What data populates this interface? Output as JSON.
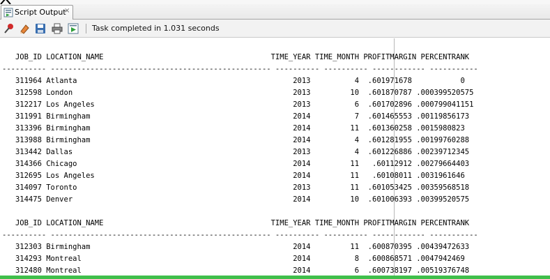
{
  "panel": {
    "tab_title": "Script Output",
    "tab_close": "×",
    "status": "Task completed in 1.031 seconds"
  },
  "icons": {
    "tab": "script-output-icon",
    "toolbar": [
      "pin-icon",
      "eraser-icon",
      "save-icon",
      "print-icon",
      "run-script-icon"
    ]
  },
  "colors": {
    "status_bar": "#3fbf4a"
  },
  "output": {
    "lines": [
      "",
      "   JOB_ID LOCATION_NAME                                      TIME_YEAR TIME_MONTH PROFITMARGIN PERCENTRANK",
      "---------- -------------------------------------------------- ---------- ---------- ------------ -----------",
      "   311964 Atlanta                                                 2013          4  .601971678           0",
      "   312598 London                                                  2013         10  .601870787 .000399520575",
      "   312217 Los Angeles                                             2013          6  .601702896 .000799041151",
      "   311991 Birmingham                                              2014          7  .601465553 .00119856173",
      "   313396 Birmingham                                              2014         11  .601360258 .0015980823",
      "   313988 Birmingham                                              2014          4  .601281955 .00199760288",
      "   313442 Dallas                                                  2013          4  .601226886 .00239712345",
      "   314366 Chicago                                                 2014         11   .60112912 .00279664403",
      "   312695 Los Angeles                                             2014         11   .60108011 .0031961646",
      "   314097 Toronto                                                 2013         11  .601053425 .00359568518",
      "   314475 Denver                                                  2014         10  .601006393 .00399520575",
      "",
      "   JOB_ID LOCATION_NAME                                      TIME_YEAR TIME_MONTH PROFITMARGIN PERCENTRANK",
      "---------- -------------------------------------------------- ---------- ---------- ------------ -----------",
      "   312303 Birmingham                                              2014         11  .600870395 .00439472633",
      "   314293 Montreal                                                2014          8  .600868571 .0047942469",
      "   312480 Montreal                                                2014          6  .600738197 .00519376748"
    ]
  }
}
